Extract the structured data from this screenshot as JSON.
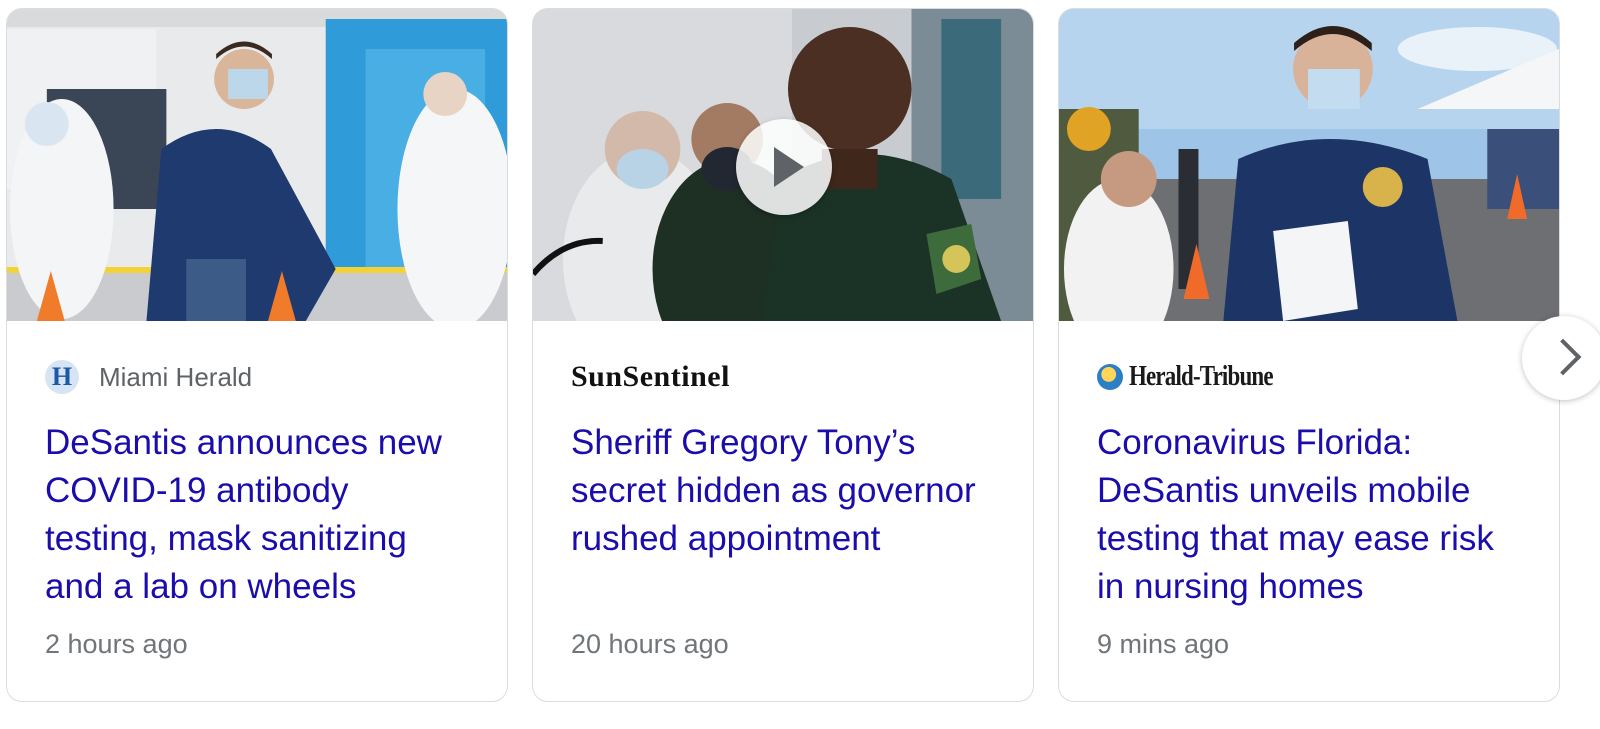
{
  "cards": [
    {
      "source": "Miami Herald",
      "source_icon_letter": "H",
      "headline": "DeSantis announces new COVID-19 antibody testing, mask sanitizing and a lab on wheels",
      "time": "2 hours ago",
      "thumbnail": "photo-desantis-testing-site"
    },
    {
      "source": "SunSentinel",
      "headline": "Sheriff Gregory Tony’s secret hidden as governor rushed appointment",
      "time": "20 hours ago",
      "thumbnail": "photo-sheriff-press-conference",
      "has_video": true
    },
    {
      "source": "Herald-Tribune",
      "headline": "Coronavirus Florida: DeSantis unveils mobile testing that may ease risk in nursing homes",
      "time": "9 mins ago",
      "thumbnail": "photo-desantis-mobile-testing"
    }
  ],
  "colors": {
    "headline_link": "#1a0dab",
    "meta_text": "#70757a",
    "border": "#dadce0"
  },
  "icons": {
    "play": "play-icon",
    "next": "chevron-right-icon"
  }
}
